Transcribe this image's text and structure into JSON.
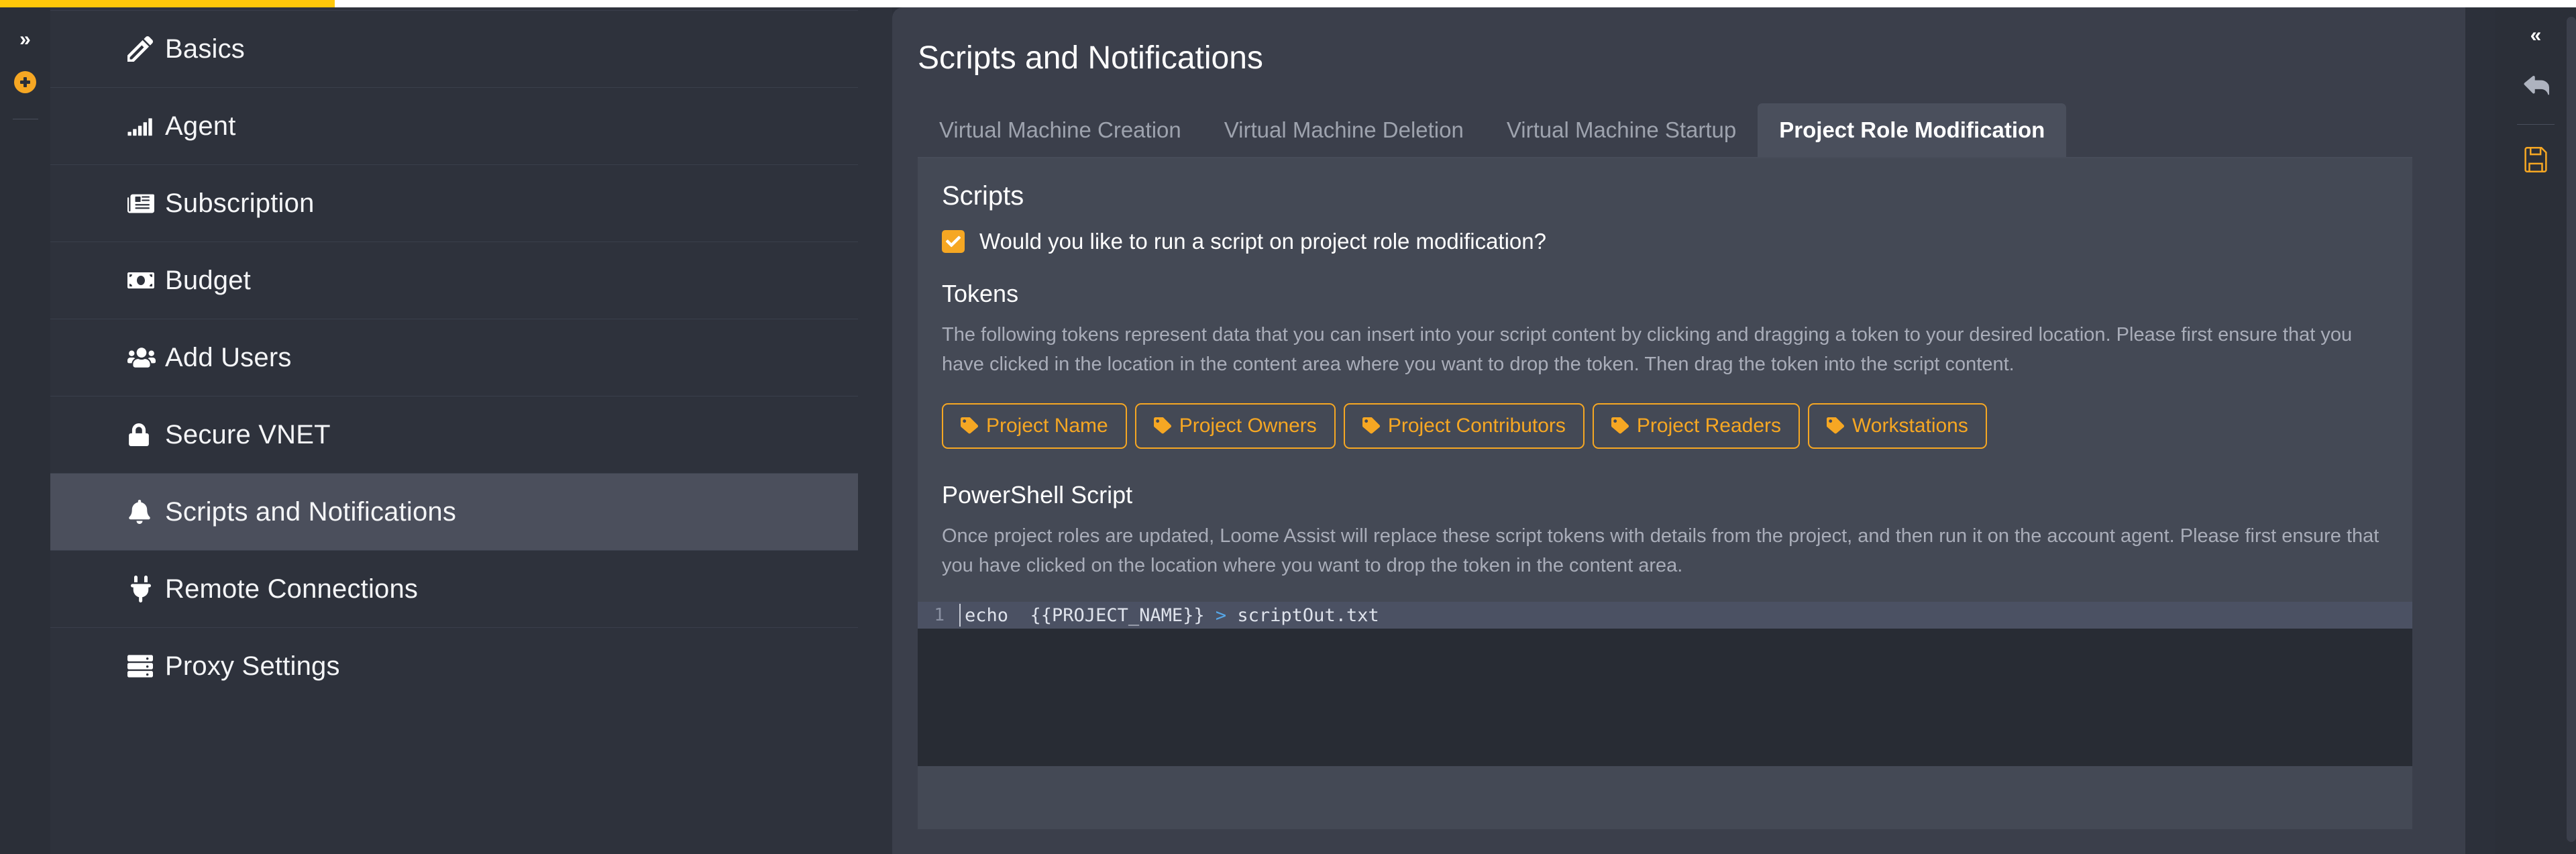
{
  "progress": {
    "percent": 13,
    "fill_color": "#ffc80a",
    "track_color": "#ffffff"
  },
  "theme": {
    "accent": "#f6a723",
    "panel_bg": "#3b3f4b",
    "card_bg": "#444955",
    "sidebar_bg": "#2e323c",
    "rail_bg": "#2b2f38",
    "editor_bg": "#282c34",
    "active_line_bg": "#4b5163"
  },
  "left_rail": {
    "expand_label": "»",
    "add_label": "+"
  },
  "sidebar": {
    "items": [
      {
        "label": "Basics",
        "icon": "pencil-icon",
        "active": false
      },
      {
        "label": "Agent",
        "icon": "signal-bars-icon",
        "active": false
      },
      {
        "label": "Subscription",
        "icon": "newspaper-icon",
        "active": false
      },
      {
        "label": "Budget",
        "icon": "money-bill-icon",
        "active": false
      },
      {
        "label": "Add Users",
        "icon": "users-icon",
        "active": false
      },
      {
        "label": "Secure VNET",
        "icon": "lock-icon",
        "active": false
      },
      {
        "label": "Scripts and Notifications",
        "icon": "bell-icon",
        "active": true
      },
      {
        "label": "Remote Connections",
        "icon": "plug-icon",
        "active": false
      },
      {
        "label": "Proxy Settings",
        "icon": "server-icon",
        "active": false
      }
    ]
  },
  "main": {
    "title": "Scripts and Notifications",
    "tabs": [
      {
        "label": "Virtual Machine Creation",
        "active": false
      },
      {
        "label": "Virtual Machine Deletion",
        "active": false
      },
      {
        "label": "Virtual Machine Startup",
        "active": false
      },
      {
        "label": "Project Role Modification",
        "active": true
      }
    ],
    "scripts_heading": "Scripts",
    "run_script_checkbox": {
      "label": "Would you like to run a script on project role modification?",
      "checked": true
    },
    "tokens_heading": "Tokens",
    "tokens_help": "The following tokens represent data that you can insert into your script content by clicking and dragging a token to your desired location. Please first ensure that you have clicked in the location in the content area where you want to drop the token. Then drag the token into the script content.",
    "token_buttons": [
      {
        "label": "Project Name",
        "icon": "tag-icon"
      },
      {
        "label": "Project Owners",
        "icon": "tag-icon"
      },
      {
        "label": "Project Contributors",
        "icon": "tag-icon"
      },
      {
        "label": "Project Readers",
        "icon": "tag-icon"
      },
      {
        "label": "Workstations",
        "icon": "tag-icon"
      }
    ],
    "powershell_heading": "PowerShell Script",
    "powershell_help": "Once project roles are updated, Loome Assist will replace these script tokens with details from the project, and then run it on the account agent. Please first ensure that you have clicked on the location where you want to drop the token in the content area.",
    "editor": {
      "line_number": "1",
      "code_before_op": "echo  {{PROJECT_NAME}} ",
      "code_op": ">",
      "code_after_op": " scriptOut.txt"
    }
  },
  "right_rail": {
    "collapse_label": "«",
    "back_icon": "undo-arrow-icon",
    "save_icon": "floppy-disk-save-icon"
  }
}
